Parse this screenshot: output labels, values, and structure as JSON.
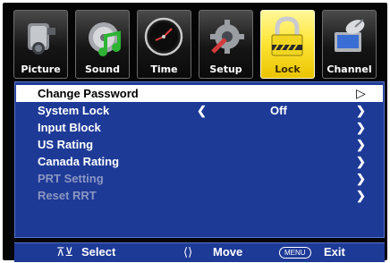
{
  "tabs": [
    {
      "label": "Picture",
      "icon": "camcorder-icon"
    },
    {
      "label": "Sound",
      "icon": "music-note-icon"
    },
    {
      "label": "Time",
      "icon": "clock-icon"
    },
    {
      "label": "Setup",
      "icon": "wrench-gear-icon"
    },
    {
      "label": "Lock",
      "icon": "padlock-icon",
      "active": true
    },
    {
      "label": "Channel",
      "icon": "satellite-dish-icon"
    }
  ],
  "menu": {
    "items": [
      {
        "label": "Change Password",
        "selected": true
      },
      {
        "label": "System Lock",
        "value": "Off"
      },
      {
        "label": "Input Block"
      },
      {
        "label": "US Rating"
      },
      {
        "label": "Canada Rating"
      },
      {
        "label": "PRT Setting",
        "disabled": true
      },
      {
        "label": "Reset RRT",
        "disabled": true
      }
    ]
  },
  "footer": {
    "select_label": "Select",
    "move_label": "Move",
    "menu_key": "MENU",
    "exit_label": "Exit"
  },
  "colors": {
    "panel": "#1e3a97",
    "active_tab": "#ffe63a",
    "selected_row": "#ffffff",
    "disabled_text": "#8b97c2"
  }
}
